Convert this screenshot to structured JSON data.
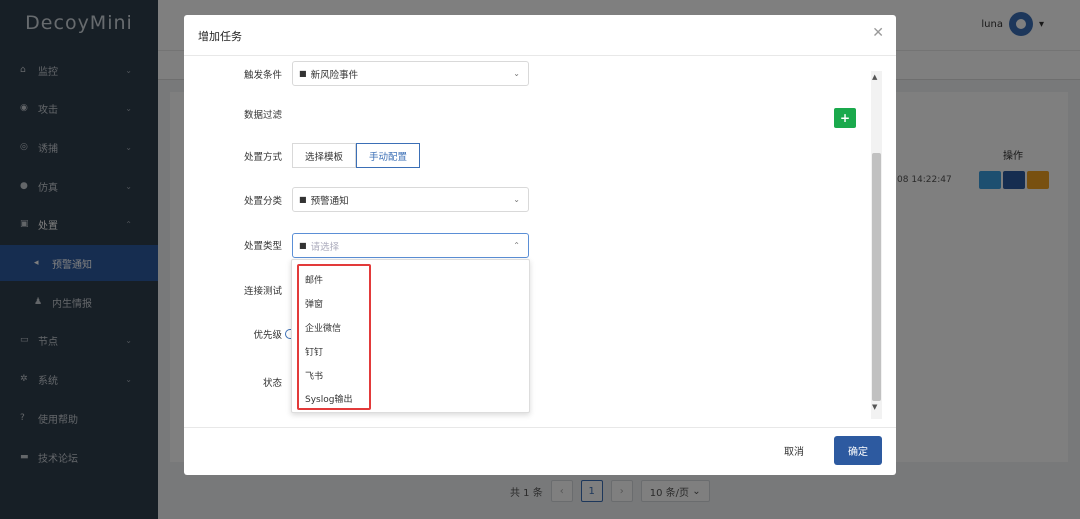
{
  "app": {
    "logo": "DecoyMini"
  },
  "sidebar": {
    "items": [
      {
        "icon": "home-icon",
        "label": "监控"
      },
      {
        "icon": "target-icon",
        "label": "攻击"
      },
      {
        "icon": "lure-icon",
        "label": "诱捕"
      },
      {
        "icon": "simulate-icon",
        "label": "仿真"
      },
      {
        "icon": "briefcase-icon",
        "label": "处置"
      },
      {
        "icon": "megaphone-icon",
        "label": "预警通知"
      },
      {
        "icon": "person-icon",
        "label": "内生情报"
      },
      {
        "icon": "monitor-icon",
        "label": "节点"
      },
      {
        "icon": "gear-icon",
        "label": "系统"
      },
      {
        "icon": "question-icon",
        "label": "使用帮助"
      },
      {
        "icon": "chat-icon",
        "label": "技术论坛"
      }
    ]
  },
  "header": {
    "username": "luna"
  },
  "background_table": {
    "op_header": "操作",
    "time_fragment": "08 14:22:47"
  },
  "pagination": {
    "total": "共 1 条",
    "current_page": "1",
    "page_size": "10 条/页"
  },
  "modal": {
    "title": "增加任务",
    "fields": {
      "trigger_label": "触发条件",
      "trigger_value": "新风险事件",
      "filter_label": "数据过滤",
      "method_label": "处置方式",
      "method_options": [
        "选择模板",
        "手动配置"
      ],
      "method_selected": "手动配置",
      "category_label": "处置分类",
      "category_value": "预警通知",
      "type_label": "处置类型",
      "type_placeholder": "请选择",
      "test_label": "连接测试",
      "priority_label": "优先级",
      "status_label": "状态"
    },
    "type_options": [
      "邮件",
      "弹窗",
      "企业微信",
      "钉钉",
      "飞书",
      "Syslog输出"
    ],
    "cancel_label": "取消",
    "ok_label": "确定"
  },
  "colors": {
    "primary": "#2d5aa0",
    "add_green": "#1aa94c",
    "highlight_red": "#e23a3a",
    "sidebar_bg": "#2f3e4d"
  }
}
